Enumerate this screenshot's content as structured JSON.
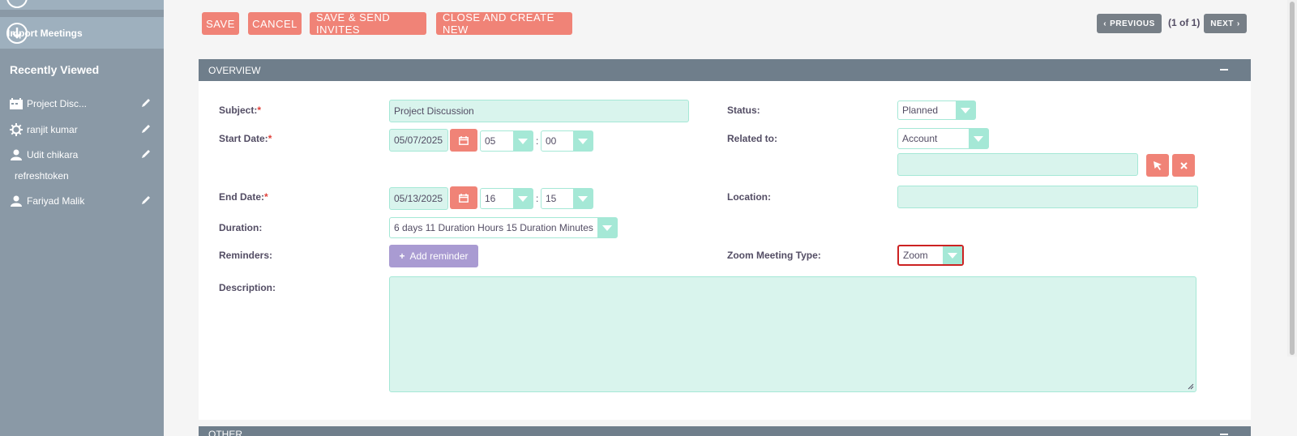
{
  "sidebar": {
    "import_label": "Import Meetings",
    "recently_viewed_heading": "Recently Viewed",
    "items": [
      {
        "label": "Project Disc...",
        "icon": "meeting-calendar-icon"
      },
      {
        "label": "ranjit kumar",
        "icon": "gear-icon"
      },
      {
        "label": "Udit chikara",
        "icon": "person-icon"
      },
      {
        "label": "Fariyad Malik",
        "icon": "person-icon"
      }
    ],
    "sub_label": "refreshtoken"
  },
  "toolbar": {
    "save": "SAVE",
    "cancel": "CANCEL",
    "save_send": "SAVE & SEND INVITES",
    "close_create": "CLOSE AND CREATE NEW",
    "previous": "PREVIOUS",
    "pager": "(1 of 1)",
    "next": "NEXT"
  },
  "overview": {
    "title": "OVERVIEW",
    "subject_label": "Subject:",
    "subject_value": "Project Discussion",
    "start_label": "Start Date:",
    "start_date": "05/07/2025",
    "start_hour": "05",
    "start_min": "00",
    "end_label": "End Date:",
    "end_date": "05/13/2025",
    "end_hour": "16",
    "end_min": "15",
    "duration_label": "Duration:",
    "duration_value": "6 days 11 Duration Hours 15 Duration Minutes",
    "reminders_label": "Reminders:",
    "add_reminder": "Add reminder",
    "description_label": "Description:",
    "status_label": "Status:",
    "status_value": "Planned",
    "related_label": "Related to:",
    "related_value": "Account",
    "location_label": "Location:",
    "zoom_label": "Zoom Meeting Type:",
    "zoom_value": "Zoom",
    "required_mark": "*"
  },
  "other": {
    "title": "OTHER"
  },
  "colors": {
    "accent": "#f08377",
    "field_bg": "#d9f4ed",
    "panel_header": "#6f7e8b",
    "sidebar": "#8a99a6"
  }
}
